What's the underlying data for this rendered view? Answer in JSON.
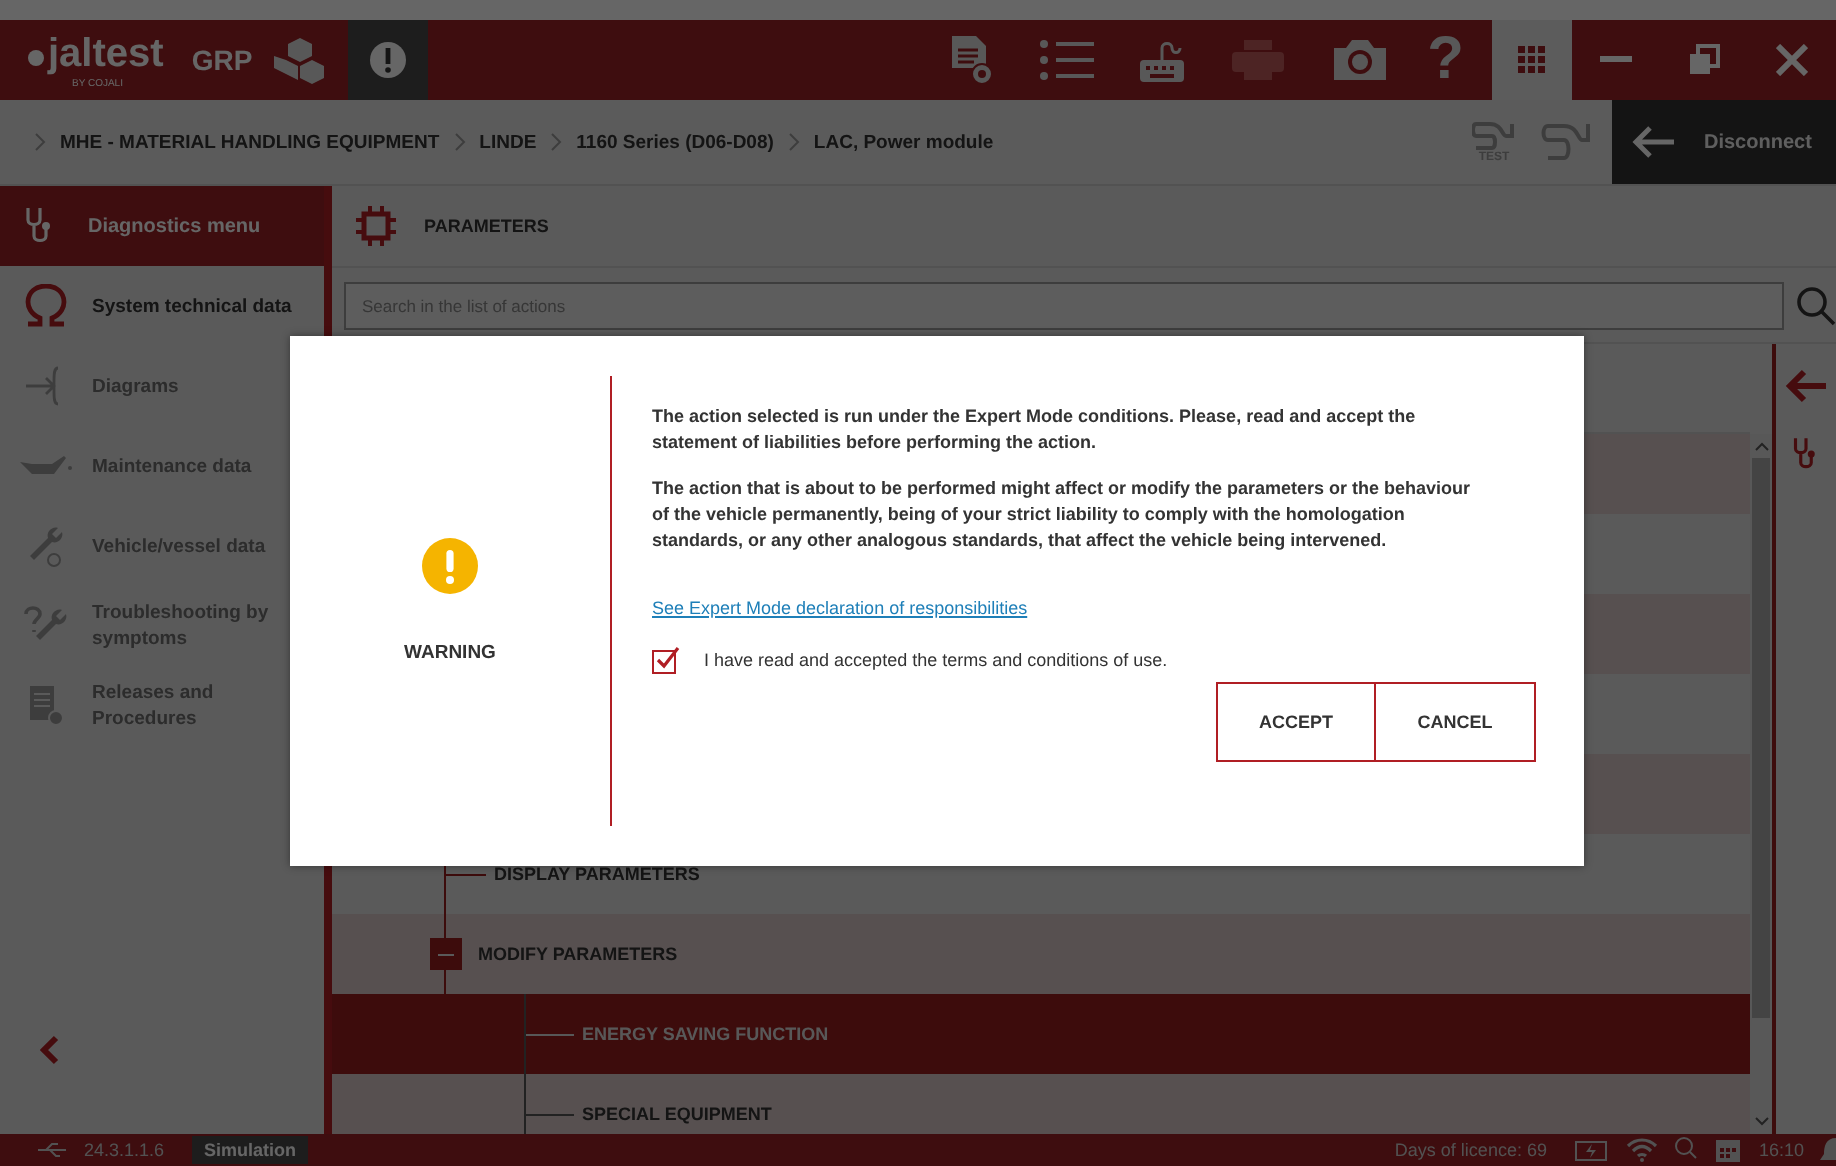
{
  "top_bar": {
    "logo": "jaltest",
    "logo_sub": "BY COJALI",
    "product": "GRP",
    "help": "?"
  },
  "breadcrumb": {
    "items": [
      "MHE - MATERIAL HANDLING EQUIPMENT",
      "LINDE",
      "1160 Series (D06-D08)",
      "LAC, Power module"
    ],
    "test_label": "TEST",
    "disconnect": "Disconnect"
  },
  "sidebar": {
    "title": "Diagnostics menu",
    "items": [
      {
        "label": "System technical data",
        "kind": "omega",
        "disabled": false
      },
      {
        "label": "Diagrams",
        "kind": "diagram",
        "disabled": true
      },
      {
        "label": "Maintenance data",
        "kind": "oilcan",
        "disabled": true
      },
      {
        "label": "Vehicle/vessel data",
        "kind": "wrench",
        "disabled": true
      },
      {
        "label": "Troubleshooting by symptoms",
        "kind": "troubleshoot",
        "disabled": true
      },
      {
        "label": "Releases and Procedures",
        "kind": "document",
        "disabled": true
      }
    ]
  },
  "panel": {
    "title": "PARAMETERS",
    "search": {
      "placeholder": "Search in the list of actions"
    },
    "tree": [
      {
        "label": "DISPLAY PARAMETERS",
        "selected": false
      },
      {
        "label": "MODIFY PARAMETERS",
        "selected": false,
        "expanded": true,
        "children": [
          {
            "label": "ENERGY SAVING FUNCTION",
            "selected": true
          },
          {
            "label": "SPECIAL EQUIPMENT",
            "selected": false
          }
        ]
      }
    ]
  },
  "dialog": {
    "title": "WARNING",
    "paragraphs": [
      "The action selected is run under the Expert Mode conditions. Please, read and accept the statement of liabilities before performing the action.",
      "The action that is about to be performed might affect or modify the parameters or the behaviour of the vehicle permanently, being of your strict liability to comply with the homologation standards, or any other analogous standards, that affect the vehicle being intervened."
    ],
    "link": "See Expert Mode declaration of responsibilities",
    "agree": {
      "label": "I have read and accepted the terms and conditions of use.",
      "checked": true
    },
    "buttons": [
      "ACCEPT",
      "CANCEL"
    ]
  },
  "status_bar": {
    "version": "24.3.1.1.6",
    "mode": "Simulation",
    "licence": "Days of licence: 69",
    "time": "16:10"
  }
}
